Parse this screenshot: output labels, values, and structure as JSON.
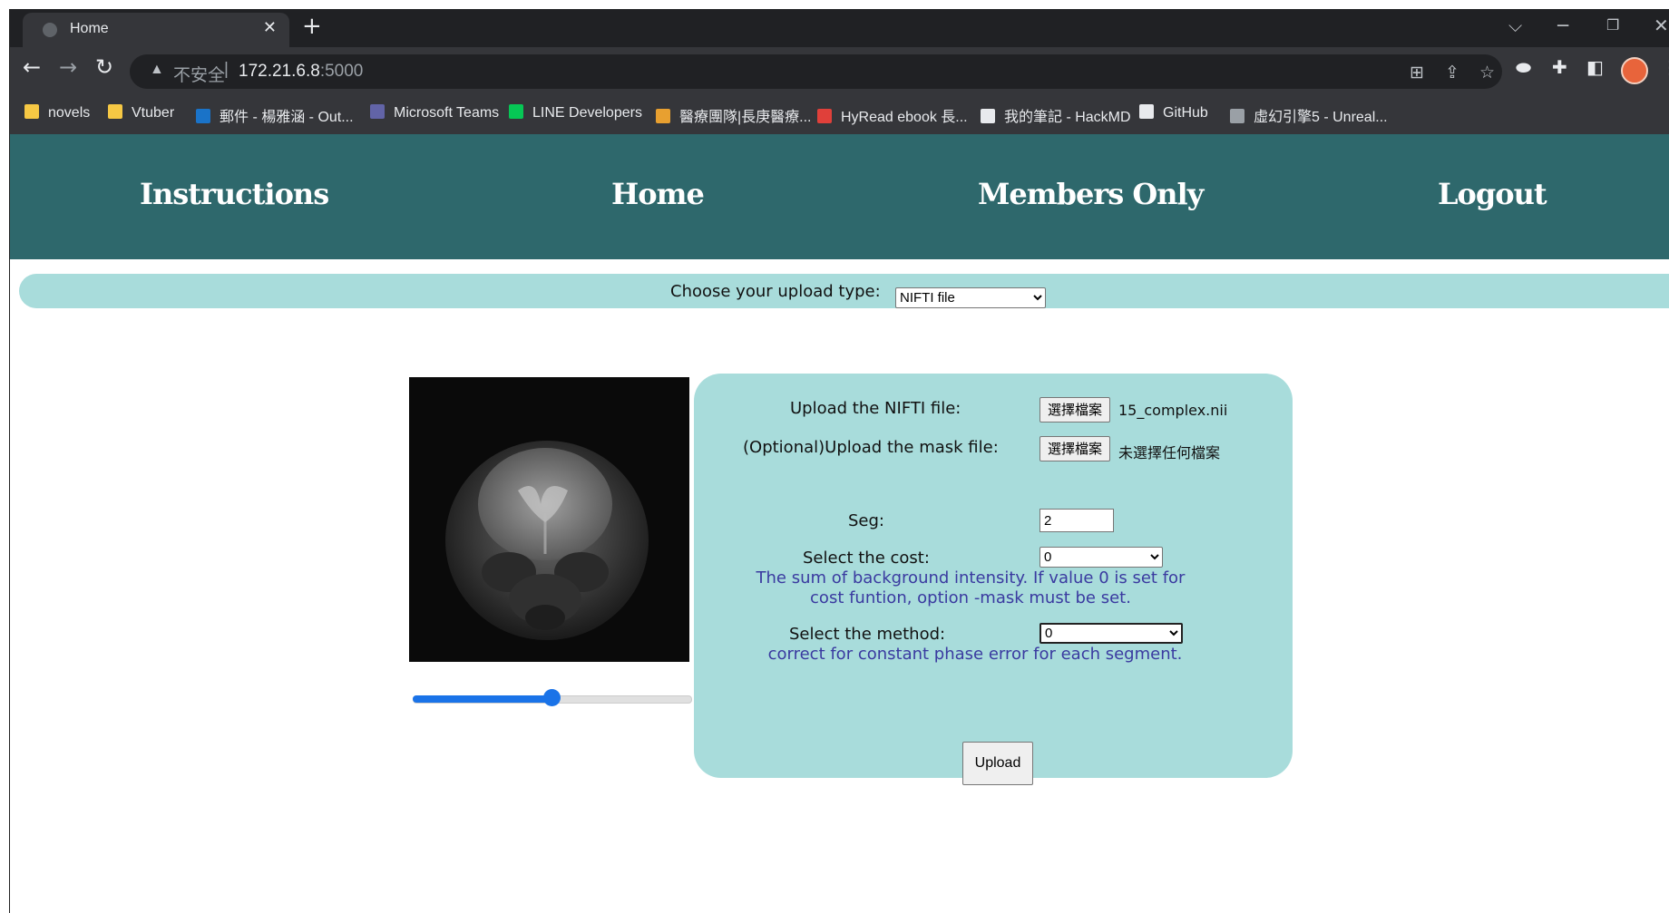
{
  "browser": {
    "tab_title": "Home",
    "omnibox": {
      "security_label": "不安全",
      "host": "172.21.6.8",
      "port": ":5000"
    },
    "bookmarks": [
      {
        "label": "novels",
        "icon": "folder-icon",
        "color": "#f6c844"
      },
      {
        "label": "Vtuber",
        "icon": "folder-icon",
        "color": "#f6c844"
      },
      {
        "label": "郵件 - 楊雅涵 - Out...",
        "icon": "outlook-icon",
        "color": "#1a73c8"
      },
      {
        "label": "Microsoft Teams",
        "icon": "teams-icon",
        "color": "#6264a7"
      },
      {
        "label": "LINE Developers",
        "icon": "line-icon",
        "color": "#06c755"
      },
      {
        "label": "醫療團隊|長庚醫療...",
        "icon": "medical-icon",
        "color": "#e8a030"
      },
      {
        "label": "HyRead ebook 長...",
        "icon": "hyread-icon",
        "color": "#e0403a"
      },
      {
        "label": "我的筆記 - HackMD",
        "icon": "document-icon",
        "color": "#e8eaed"
      },
      {
        "label": "GitHub",
        "icon": "github-icon",
        "color": "#e8eaed"
      },
      {
        "label": "虛幻引擎5 - Unreal...",
        "icon": "unreal-icon",
        "color": "#9aa0a6"
      }
    ]
  },
  "nav": {
    "instructions": "Instructions",
    "home": "Home",
    "members": "Members Only",
    "logout": "Logout"
  },
  "upload_type": {
    "label": "Choose your upload type:",
    "selected": "NIFTI file"
  },
  "form": {
    "nifti_label": "Upload the NIFTI file:",
    "nifti_button": "選擇檔案",
    "nifti_filename": "15_complex.nii",
    "mask_label": "(Optional)Upload the mask file:",
    "mask_button": "選擇檔案",
    "mask_filename": "未選擇任何檔案",
    "seg_label": "Seg:",
    "seg_value": "2",
    "cost_label": "Select the cost:",
    "cost_selected": "0",
    "cost_hint_line1": "The sum of background intensity. If value 0 is set for",
    "cost_hint_line2": "cost funtion, option -mask must be set.",
    "method_label": "Select the method:",
    "method_selected": "0",
    "method_hint": "correct for constant phase error for each segment.",
    "upload_button": "Upload"
  },
  "slice_slider": {
    "fraction": 0.5
  },
  "colors": {
    "navbar": "#2e686c",
    "panel": "#a8dcdb",
    "hint_text": "#3a3aa0",
    "slider": "#1a73e8"
  }
}
